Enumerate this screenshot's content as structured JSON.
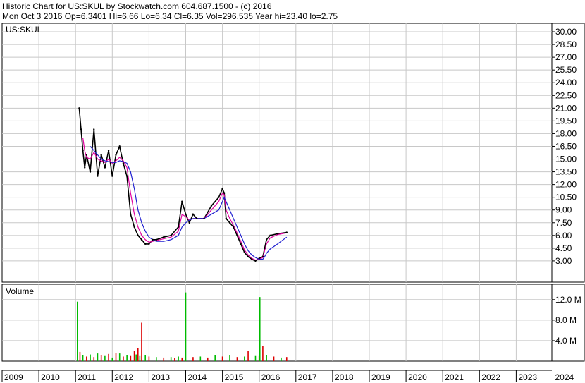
{
  "header": {
    "line1": "Historic Chart for US:SKUL by Stockwatch.com 604.687.1500 - (c) 2016",
    "line2": "Mon Oct  3 2016  Op=6.3401  Hi=6.66  Lo=6.34  Cl=6.35  Vol=296,535  Year hi=23.40  lo=2.75"
  },
  "colors": {
    "price": "#000000",
    "ma_short": "#e000a0",
    "ma_long": "#2020d0",
    "vol_up": "#00bb00",
    "vol_down": "#dd0000",
    "grid": "#c8c8c8",
    "frame": "#000000"
  },
  "chart_data": [
    {
      "type": "line",
      "label": "US:SKUL",
      "y_ticks": [
        "3.00",
        "4.50",
        "6.00",
        "7.50",
        "9.00",
        "10.50",
        "12.00",
        "13.50",
        "15.00",
        "16.50",
        "18.00",
        "19.50",
        "21.00",
        "22.50",
        "24.00",
        "25.50",
        "27.00",
        "28.50",
        "30.00"
      ],
      "ylim": [
        0.5,
        31.0
      ],
      "x": [
        2011.1,
        2011.15,
        2011.2,
        2011.25,
        2011.3,
        2011.4,
        2011.5,
        2011.6,
        2011.7,
        2011.8,
        2011.9,
        2012.0,
        2012.1,
        2012.2,
        2012.3,
        2012.4,
        2012.5,
        2012.6,
        2012.7,
        2012.8,
        2012.9,
        2013.0,
        2013.1,
        2013.2,
        2013.4,
        2013.6,
        2013.8,
        2013.9,
        2014.0,
        2014.1,
        2014.2,
        2014.3,
        2014.5,
        2014.7,
        2014.9,
        2015.0,
        2015.05,
        2015.1,
        2015.2,
        2015.3,
        2015.4,
        2015.5,
        2015.6,
        2015.7,
        2015.8,
        2015.9,
        2016.0,
        2016.1,
        2016.15,
        2016.2,
        2016.3,
        2016.5,
        2016.75
      ],
      "series": [
        {
          "name": "Price",
          "values": [
            21.0,
            18.5,
            16.0,
            14.0,
            15.5,
            13.5,
            18.5,
            13.0,
            15.5,
            14.0,
            16.0,
            13.0,
            15.5,
            16.5,
            14.5,
            13.0,
            8.5,
            7.0,
            6.0,
            5.5,
            5.0,
            5.0,
            5.5,
            5.5,
            5.8,
            6.0,
            7.0,
            10.0,
            8.5,
            7.5,
            8.5,
            8.0,
            8.0,
            9.5,
            10.5,
            11.5,
            11.0,
            8.0,
            7.5,
            7.0,
            6.0,
            5.0,
            4.0,
            3.5,
            3.2,
            3.0,
            3.3,
            3.5,
            4.5,
            5.5,
            6.0,
            6.2,
            6.35
          ]
        },
        {
          "name": "MA short",
          "values": [
            null,
            null,
            17.5,
            16.0,
            15.2,
            15.0,
            15.8,
            15.0,
            14.8,
            14.6,
            15.0,
            14.5,
            14.8,
            15.2,
            14.8,
            14.0,
            11.0,
            8.5,
            7.0,
            6.0,
            5.5,
            5.2,
            5.3,
            5.4,
            5.6,
            5.8,
            6.5,
            8.5,
            8.2,
            7.8,
            8.0,
            8.0,
            8.0,
            9.0,
            10.0,
            11.0,
            10.8,
            9.0,
            8.0,
            7.2,
            6.3,
            5.3,
            4.3,
            3.7,
            3.3,
            3.1,
            3.2,
            3.4,
            4.2,
            5.0,
            5.7,
            6.1,
            6.3
          ]
        },
        {
          "name": "MA long",
          "values": [
            null,
            null,
            null,
            null,
            null,
            16.5,
            16.0,
            15.5,
            15.0,
            14.8,
            14.7,
            14.6,
            14.6,
            14.8,
            14.7,
            14.5,
            13.5,
            11.5,
            9.0,
            7.5,
            6.5,
            5.8,
            5.5,
            5.3,
            5.3,
            5.5,
            6.0,
            7.0,
            7.5,
            7.8,
            8.0,
            8.0,
            8.0,
            8.5,
            9.0,
            10.0,
            10.5,
            10.0,
            9.0,
            8.0,
            7.0,
            6.0,
            5.0,
            4.2,
            3.7,
            3.4,
            3.2,
            3.2,
            3.5,
            3.9,
            4.4,
            5.0,
            5.8
          ]
        }
      ]
    },
    {
      "type": "bar",
      "label": "Volume",
      "y_ticks": [
        "4.0 M",
        "8.0 M",
        "12.0 M"
      ],
      "ylim": [
        0,
        15
      ],
      "x": [
        2011.05,
        2011.12,
        2011.2,
        2011.3,
        2011.4,
        2011.5,
        2011.6,
        2011.7,
        2011.8,
        2011.9,
        2012.0,
        2012.1,
        2012.2,
        2012.3,
        2012.4,
        2012.5,
        2012.6,
        2012.65,
        2012.7,
        2012.75,
        2012.8,
        2012.9,
        2013.0,
        2013.2,
        2013.4,
        2013.6,
        2013.7,
        2013.8,
        2013.9,
        2014.0,
        2014.2,
        2014.4,
        2014.6,
        2014.8,
        2015.0,
        2015.2,
        2015.4,
        2015.6,
        2015.7,
        2015.9,
        2016.0,
        2016.02,
        2016.1,
        2016.2,
        2016.4,
        2016.6,
        2016.75
      ],
      "values": [
        11.6,
        1.8,
        1.2,
        0.9,
        1.3,
        0.8,
        1.5,
        1.2,
        1.0,
        1.4,
        0.7,
        1.6,
        1.5,
        0.9,
        1.2,
        1.0,
        2.0,
        1.3,
        2.5,
        1.0,
        7.5,
        1.2,
        0.9,
        0.8,
        0.7,
        0.8,
        0.6,
        0.9,
        0.7,
        13.4,
        0.8,
        0.9,
        0.7,
        1.1,
        0.9,
        1.1,
        0.8,
        0.9,
        2.0,
        1.0,
        1.0,
        12.5,
        3.0,
        1.2,
        0.9,
        0.7,
        0.8
      ],
      "up": [
        true,
        false,
        true,
        false,
        true,
        false,
        true,
        false,
        true,
        false,
        true,
        false,
        true,
        false,
        true,
        false,
        false,
        true,
        false,
        true,
        false,
        true,
        false,
        true,
        false,
        true,
        false,
        true,
        false,
        true,
        false,
        true,
        false,
        true,
        false,
        true,
        false,
        true,
        false,
        true,
        false,
        true,
        false,
        true,
        false,
        true,
        false
      ]
    }
  ],
  "x_axis": {
    "labels": [
      "2009",
      "2010",
      "2011",
      "2012",
      "2013",
      "2014",
      "2015",
      "2016",
      "2017",
      "2018",
      "2019",
      "2020",
      "2021",
      "2022",
      "2023",
      "2024"
    ]
  }
}
